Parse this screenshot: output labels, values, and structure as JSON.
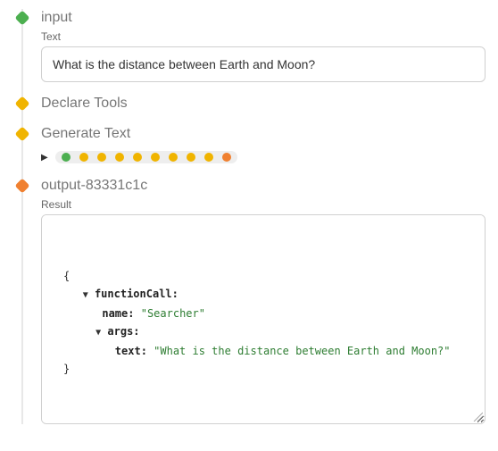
{
  "nodes": {
    "input": {
      "title": "input",
      "field_label": "Text",
      "value": "What is the distance between Earth and Moon?"
    },
    "declare": {
      "title": "Declare Tools"
    },
    "generate": {
      "title": "Generate Text",
      "progress_dots": [
        "g",
        "y",
        "y",
        "y",
        "y",
        "y",
        "y",
        "y",
        "y",
        "o"
      ]
    },
    "output": {
      "title": "output-83331c1c",
      "field_label": "Result",
      "json": {
        "open": "{",
        "functionCall_label": "functionCall:",
        "name_key": "name:",
        "name_val": "\"Searcher\"",
        "args_label": "args:",
        "text_key": "text:",
        "text_val": "\"What is the distance between Earth and Moon?\"",
        "close": "}"
      }
    }
  },
  "icons": {
    "disclosure_right": "▶",
    "disclosure_down": "▼"
  }
}
